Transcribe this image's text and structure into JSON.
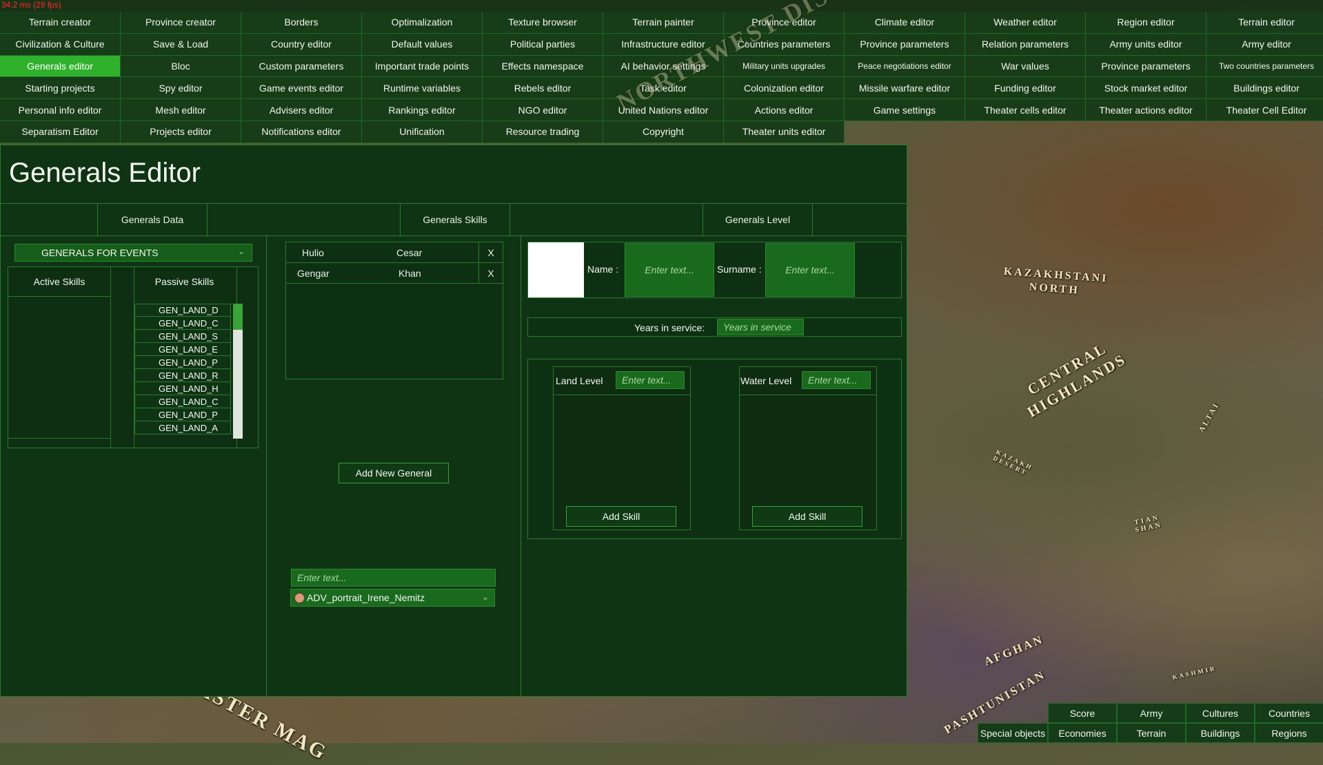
{
  "fps_text": "34.2 ms (29 fps)",
  "top_menu": [
    [
      "Terrain creator",
      "Province creator",
      "Borders",
      "Optimalization",
      "Texture browser",
      "Terrain painter",
      "Province editor",
      "Climate editor",
      "Weather editor",
      "Region editor",
      "Terrain editor"
    ],
    [
      "Civilization & Culture",
      "Save & Load",
      "Country editor",
      "Default values",
      "Political parties",
      "Infrastructure editor",
      "Countries parameters",
      "Province parameters",
      "Relation parameters",
      "Army units editor",
      "Army editor"
    ],
    [
      "Generals editor",
      "Bloc",
      "Custom parameters",
      "Important trade points",
      "Effects namespace",
      "AI behavior settings",
      "Military units upgrades",
      "Peace negotiations editor",
      "War values",
      "Province parameters",
      "Two countries parameters"
    ],
    [
      "Starting projects",
      "Spy editor",
      "Game events editor",
      "Runtime variables",
      "Rebels editor",
      "Task editor",
      "Colonization editor",
      "Missile warfare editor",
      "Funding editor",
      "Stock market editor",
      "Buildings editor"
    ],
    [
      "Personal info editor",
      "Mesh editor",
      "Advisers editor",
      "Rankings editor",
      "NGO editor",
      "United Nations editor",
      "Actions editor",
      "Game settings",
      "Theater cells editor",
      "Theater actions editor",
      "Theater Cell Editor"
    ],
    [
      "Separatism Editor",
      "Projects editor",
      "Notifications editor",
      "Unification",
      "Resource trading",
      "Copyright",
      "Theater units editor",
      "",
      "",
      "",
      ""
    ]
  ],
  "active_menu_item": "Generals editor",
  "map_labels": {
    "kaz_north": "KAZAKHSTANI NORTH",
    "central_highlands": "CENTRAL HIGHLANDS",
    "afghan": "AFGHAN",
    "pashtunistan": "PASHTUNISTAN",
    "altai": "ALTAI",
    "tian_shan": "TIAN SHAN",
    "kazakh_desert": "KAZAKH DESERT",
    "kashmir": "KASHMIR",
    "eastern_magreb": "EASTER MAG",
    "northwest_district": "NORTHWEST DISTRICT"
  },
  "editor": {
    "title": "Generals Editor",
    "tabs": [
      "Generals Data",
      "Generals Skills",
      "Generals Level"
    ]
  },
  "left": {
    "dropdown_value": "GENERALS FOR EVENTS",
    "active_skills_header": "Active Skills",
    "passive_skills_header": "Passive Skills",
    "passive_skills": [
      "GEN_LAND_D",
      "GEN_LAND_C",
      "GEN_LAND_S",
      "GEN_LAND_E",
      "GEN_LAND_P",
      "GEN_LAND_R",
      "GEN_LAND_H",
      "GEN_LAND_C",
      "GEN_LAND_P",
      "GEN_LAND_A"
    ]
  },
  "middle": {
    "generals": [
      {
        "name": "Hulio",
        "surname": "Cesar",
        "remove": "X"
      },
      {
        "name": "Gengar",
        "surname": "Khan",
        "remove": "X"
      }
    ],
    "add_button": "Add New General",
    "text_input_placeholder": "Enter text...",
    "portrait_value": "ADV_portrait_Irene_Nemitz"
  },
  "right": {
    "name_label": "Name :",
    "name_placeholder": "Enter text...",
    "surname_label": "Surname :",
    "surname_placeholder": "Enter text...",
    "years_label": "Years in service:",
    "years_placeholder": "Years in service",
    "land_level_label": "Land Level",
    "land_level_placeholder": "Enter text...",
    "water_level_label": "Water Level",
    "water_level_placeholder": "Enter text...",
    "add_skill_land": "Add Skill",
    "add_skill_water": "Add Skill"
  },
  "bottom_menu": {
    "row1": [
      "Score",
      "Army",
      "Cultures",
      "Countries"
    ],
    "row2": [
      "Economies",
      "Terrain",
      "Buildings",
      "Regions"
    ],
    "special": "Special objects"
  },
  "colors": {
    "panel_bg": "#0f3414",
    "border": "#2a7a2e",
    "active_menu": "#2fb12c",
    "input_green": "#1a6a1e",
    "fps_text": "#ff2a2a"
  }
}
